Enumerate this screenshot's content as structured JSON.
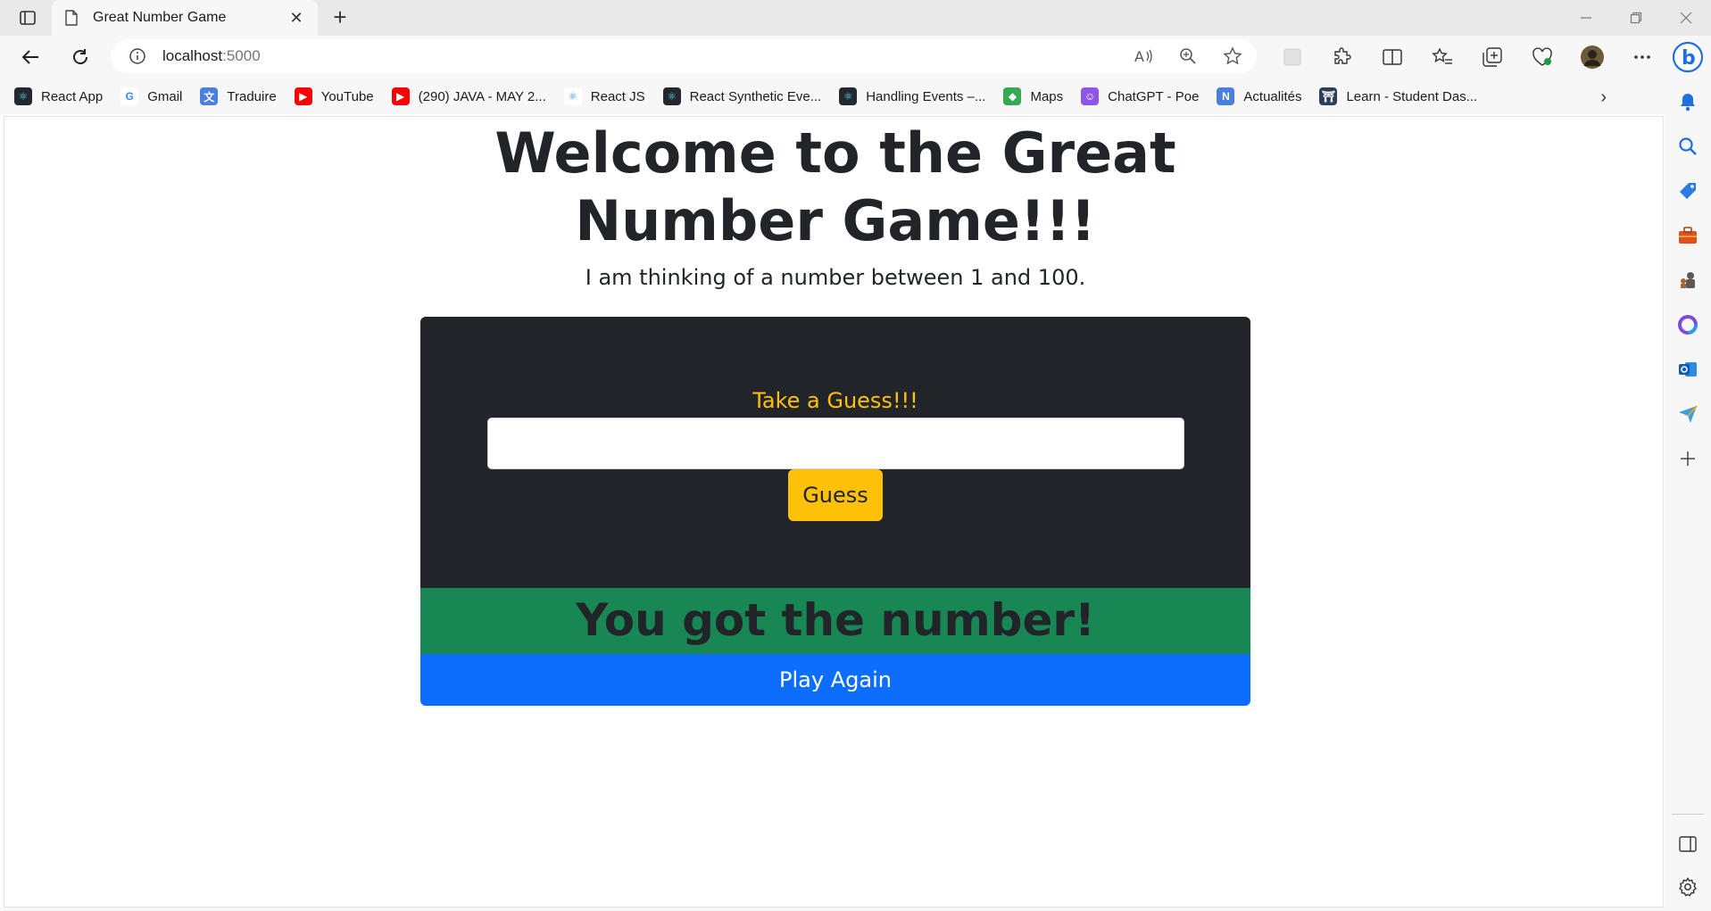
{
  "browser": {
    "tab": {
      "title": "Great Number Game",
      "close_glyph": "✕"
    },
    "new_tab_glyph": "+",
    "address": {
      "host": "localhost",
      "port": ":5000"
    },
    "bookmarks": [
      {
        "label": "React App",
        "icon": "react-icon",
        "color": "#23272f"
      },
      {
        "label": "Gmail",
        "icon": "google-icon",
        "color": "#ffffff"
      },
      {
        "label": "Traduire",
        "icon": "translate-icon",
        "color": "#4a7fe0"
      },
      {
        "label": "YouTube",
        "icon": "youtube-icon",
        "color": "#ff0000"
      },
      {
        "label": "(290) JAVA - MAY 2...",
        "icon": "youtube-icon",
        "color": "#ff0000"
      },
      {
        "label": "React JS",
        "icon": "react-icon",
        "color": "#ffffff"
      },
      {
        "label": "React Synthetic Eve...",
        "icon": "react-icon",
        "color": "#23272f"
      },
      {
        "label": "Handling Events –...",
        "icon": "react-icon",
        "color": "#23272f"
      },
      {
        "label": "Maps",
        "icon": "maps-icon",
        "color": "#34a853"
      },
      {
        "label": "ChatGPT - Poe",
        "icon": "poe-icon",
        "color": "#8f54e8"
      },
      {
        "label": "Actualités",
        "icon": "news-icon",
        "color": "#4a7fe0"
      },
      {
        "label": "Learn - Student Das...",
        "icon": "learn-icon",
        "color": "#2a3f5a"
      }
    ],
    "bookmarks_more_glyph": "›"
  },
  "page": {
    "title": "Welcome to the Great Number Game!!!",
    "subtitle": "I am thinking of a number between 1 and 100.",
    "guess_label": "Take a Guess!!!",
    "guess_value": "",
    "guess_button": "Guess",
    "result": "You got the number!",
    "play_again": "Play Again"
  },
  "colors": {
    "card_bg": "#212529",
    "accent_yellow": "#ffc107",
    "success_green": "#198754",
    "primary_blue": "#0d6efd"
  }
}
